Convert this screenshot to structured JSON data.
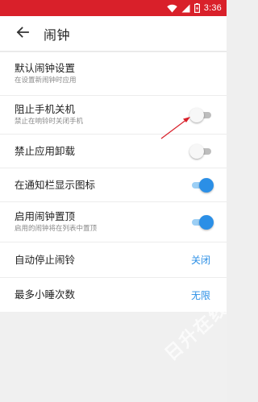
{
  "status_bar": {
    "time": "3:36",
    "icons": [
      "wifi-icon",
      "signal-icon",
      "battery-icon"
    ],
    "background_color": "#d9202a"
  },
  "app_bar": {
    "back_icon": "arrow-left-icon",
    "title": "闹钟"
  },
  "settings": [
    {
      "title": "默认闹钟设置",
      "subtitle": "在设置新闹钟时应用",
      "control": "none"
    },
    {
      "title": "阻止手机关机",
      "subtitle": "禁止在响铃时关闭手机",
      "control": "switch",
      "enabled": false
    },
    {
      "title": "禁止应用卸载",
      "subtitle": "",
      "control": "switch",
      "enabled": false
    },
    {
      "title": "在通知栏显示图标",
      "subtitle": "",
      "control": "switch",
      "enabled": true
    },
    {
      "title": "启用闹钟置顶",
      "subtitle": "启用的闹钟将在列表中置顶",
      "control": "switch",
      "enabled": true
    },
    {
      "title": "自动停止闹铃",
      "subtitle": "",
      "control": "value",
      "value": "关闭"
    },
    {
      "title": "最多小睡次数",
      "subtitle": "",
      "control": "value",
      "value": "无限"
    }
  ],
  "annotation": {
    "icon": "red-arrow-icon",
    "color": "#d9202a"
  },
  "watermark": {
    "text": "日升在线"
  },
  "colors": {
    "accent": "#2b8fe6",
    "switch_off": "#bdbdbd",
    "background": "#f0f0f0"
  }
}
